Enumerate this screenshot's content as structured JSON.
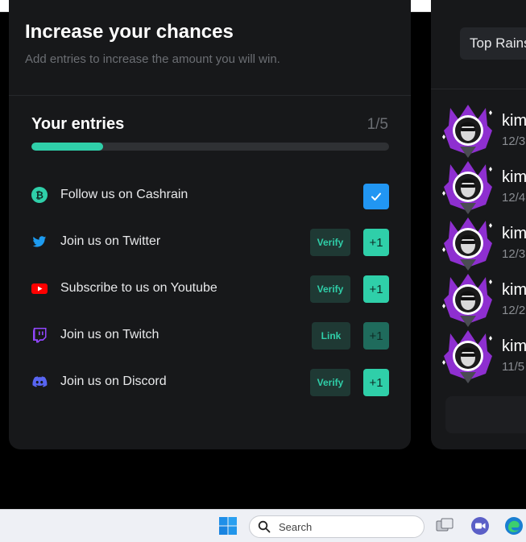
{
  "page": {
    "title": "Increase your chances",
    "subtitle": "Add entries to increase the amount you will win."
  },
  "entries": {
    "title": "Your entries",
    "count_label": "1/5",
    "progress": 0.2,
    "items": [
      {
        "icon": "cashrain-icon",
        "label": "Follow us on Cashrain",
        "action": null,
        "reward_state": "checked"
      },
      {
        "icon": "twitter-icon",
        "label": "Join us on Twitter",
        "action": "Verify",
        "reward": "+1"
      },
      {
        "icon": "youtube-icon",
        "label": "Subscribe to us on Youtube",
        "action": "Verify",
        "reward": "+1"
      },
      {
        "icon": "twitch-icon",
        "label": "Join us on Twitch",
        "action": "Link",
        "reward": "+1"
      },
      {
        "icon": "discord-icon",
        "label": "Join us on Discord",
        "action": "Verify",
        "reward": "+1"
      }
    ]
  },
  "sidebar": {
    "tab_label": "Top Rains",
    "winners": [
      {
        "name": "kim",
        "date": "12/3"
      },
      {
        "name": "kim",
        "date": "12/4"
      },
      {
        "name": "kim",
        "date": "12/3"
      },
      {
        "name": "kim",
        "date": "12/2"
      },
      {
        "name": "kim",
        "date": "11/5"
      }
    ]
  },
  "taskbar": {
    "search_label": "Search",
    "icons": [
      "windows-start-icon",
      "task-view-icon",
      "meet-icon",
      "edge-icon"
    ]
  },
  "colors": {
    "accent": "#2fcfa9",
    "card": "#17181a",
    "background": "#000000",
    "check": "#2196f3",
    "badge_purple": "#8e2fd0"
  }
}
